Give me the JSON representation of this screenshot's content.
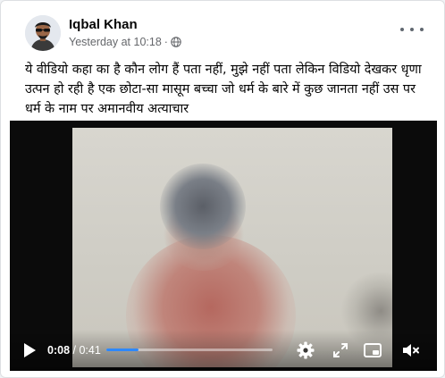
{
  "post": {
    "author": "Iqbal Khan",
    "timestamp": "Yesterday at 10:18",
    "separator": "·",
    "privacy_icon": "globe-icon",
    "more_icon": "more-horizontal-icon",
    "text": "ये वीडियो कहा का है कौन लोग हैं पता नहीं, मुझे नहीं पता लेकिन विडियो देखकर धृणा उत्पन हो रही है एक छोटा-सा मासूम बच्चा जो धर्म के बारे में कुछ जानता नहीं उस पर धर्म के नाम पर अमानवीय अत्याचार"
  },
  "video": {
    "current_time": "0:08",
    "time_separator": " / ",
    "duration": "0:41",
    "progress_fraction": 0.195,
    "icons": [
      "play-icon",
      "settings-gear-icon",
      "fullscreen-icon",
      "picture-in-picture-icon",
      "volume-muted-icon"
    ]
  },
  "colors": {
    "name": "#050505",
    "meta": "#65676b",
    "progress_fill": "#2d88ff",
    "video_bg": "#0b0b0b"
  }
}
